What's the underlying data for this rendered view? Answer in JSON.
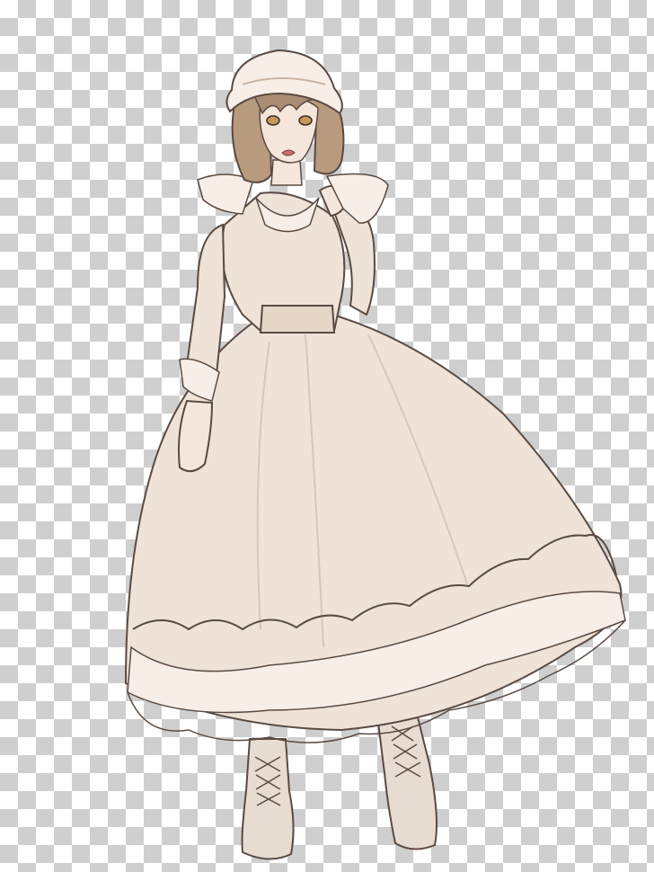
{
  "image": {
    "subject": "anime-maid-girl-illustration",
    "background": "transparency-checkerboard",
    "colors": {
      "dress": "#efe2d6",
      "dress_shadow": "#e1cfc0",
      "hair": "#b89a7e",
      "hair_dark": "#8d6e55",
      "skin": "#f5e6dc",
      "lace": "#f7efe7",
      "boots": "#e7dcd1",
      "line": "#5a4a42",
      "checker_light": "#ffffff",
      "checker_dark": "#cfcfcf"
    }
  }
}
